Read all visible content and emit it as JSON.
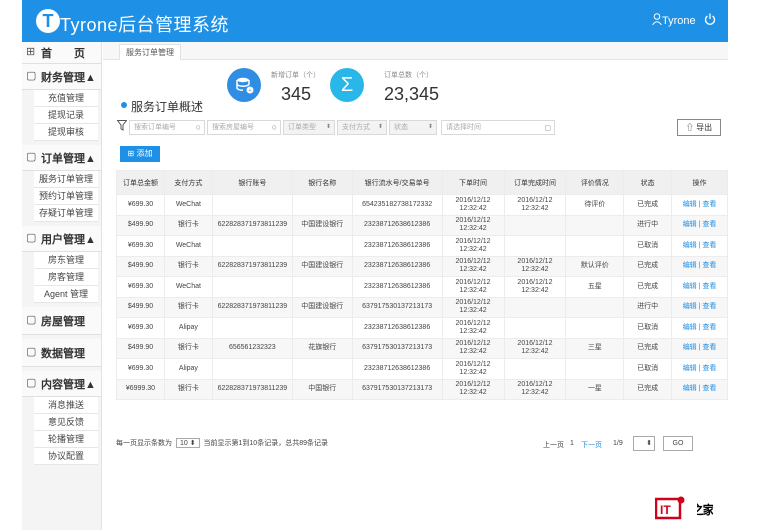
{
  "header": {
    "logo_letter": "T",
    "title": "Tyrone后台管理系统",
    "user": "Tyrone",
    "brand_color": "#1e90e6"
  },
  "sidebar": {
    "home": {
      "label": "首　　页"
    },
    "groups": [
      {
        "label": "财务管理▲",
        "icon": "money-icon",
        "items": [
          "充值管理",
          "提现记录",
          "提现审核"
        ]
      },
      {
        "label": "订单管理▲",
        "icon": "order-icon",
        "items": [
          "服务订单管理",
          "预约订单管理",
          "存疑订单管理"
        ]
      },
      {
        "label": "用户管理▲",
        "icon": "user-icon",
        "items": [
          "房东管理",
          "房客管理",
          "Agent 管理"
        ]
      },
      {
        "label": "房屋管理",
        "icon": "house-icon",
        "items": []
      },
      {
        "label": "数据管理",
        "icon": "chart-icon",
        "items": []
      },
      {
        "label": "内容管理▲",
        "icon": "content-icon",
        "items": [
          "消息推送",
          "意见反馈",
          "轮播管理",
          "协议配置"
        ]
      }
    ]
  },
  "tabs": [
    {
      "label": "服务订单管理"
    }
  ],
  "overview": {
    "title": "服务订单概述",
    "new_orders_label": "新增订单（个）",
    "new_orders_value": "345",
    "total_orders_label": "订单总数（个）",
    "total_orders_value": "23,345"
  },
  "filters": {
    "order_no_placeholder": "搜索订单编号",
    "house_no_placeholder": "搜索房屋编号",
    "order_type": "订单类型",
    "pay_method": "支付方式",
    "status": "状态",
    "time_placeholder": "请选择时间",
    "export_label": "导出"
  },
  "add_label": "添加",
  "table": {
    "headers": [
      "订单总金额",
      "支付方式",
      "银行账号",
      "银行名称",
      "银行流水号/交易单号",
      "下单时间",
      "订单完成时间",
      "评价情况",
      "状态",
      "操作"
    ],
    "rows": [
      [
        "¥699.30",
        "WeChat",
        "",
        "",
        "654235182738172332",
        "2016/12/12 12:32:42",
        "2016/12/12 12:32:42",
        "待评价",
        "已完成",
        "编辑 | 查看"
      ],
      [
        "$499.90",
        "银行卡",
        "622828371973811239",
        "中国建设银行",
        "23238712638612386",
        "2016/12/12 12:32:42",
        "",
        "",
        "进行中",
        "编辑 | 查看"
      ],
      [
        "¥699.30",
        "WeChat",
        "",
        "",
        "23238712638612386",
        "2016/12/12 12:32:42",
        "",
        "",
        "已取消",
        "编辑 | 查看"
      ],
      [
        "$499.90",
        "银行卡",
        "622828371973811239",
        "中国建设银行",
        "23238712638612386",
        "2016/12/12 12:32:42",
        "2016/12/12 12:32:42",
        "默认评价",
        "已完成",
        "编辑 | 查看"
      ],
      [
        "¥699.30",
        "WeChat",
        "",
        "",
        "23238712638612386",
        "2016/12/12 12:32:42",
        "2016/12/12 12:32:42",
        "五星",
        "已完成",
        "编辑 | 查看"
      ],
      [
        "$499.90",
        "银行卡",
        "622828371973811239",
        "中国建设银行",
        "637917530137213173",
        "2016/12/12 12:32:42",
        "",
        "",
        "进行中",
        "编辑 | 查看"
      ],
      [
        "¥699.30",
        "Alipay",
        "",
        "",
        "23238712638612386",
        "2016/12/12 12:32:42",
        "",
        "",
        "已取消",
        "编辑 | 查看"
      ],
      [
        "$499.90",
        "银行卡",
        "656561232323",
        "花旗银行",
        "637917530137213173",
        "2016/12/12 12:32:42",
        "2016/12/12 12:32:42",
        "三星",
        "已完成",
        "编辑 | 查看"
      ],
      [
        "¥699.30",
        "Alipay",
        "",
        "",
        "23238712638612386",
        "2016/12/12 12:32:42",
        "",
        "",
        "已取消",
        "编辑 | 查看"
      ],
      [
        "¥6999.30",
        "银行卡",
        "622828371973811239",
        "中国银行",
        "637917530137213173",
        "2016/12/12 12:32:42",
        "2016/12/12 12:32:42",
        "一星",
        "已完成",
        "编辑 | 查看"
      ]
    ]
  },
  "footer": {
    "page_size_prefix": "每一页显示条数为",
    "page_size": "10",
    "summary": "当前显示第1到10条记录，总共89条记录",
    "prev": "上一页",
    "current": "1",
    "next": "下一页",
    "page_info": "1/9",
    "go": "GO"
  },
  "watermark": "IT之家"
}
